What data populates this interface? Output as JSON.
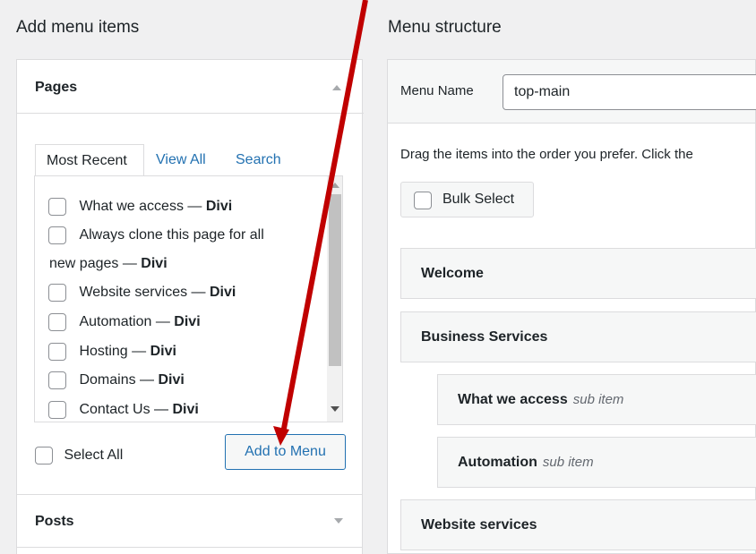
{
  "left": {
    "heading": "Add menu items",
    "pages_title": "Pages",
    "tabs": [
      "Most Recent",
      "View All",
      "Search"
    ],
    "pages": [
      {
        "title": "What we access",
        "suffix": "Divi"
      },
      {
        "title": "Always clone this page for all",
        "title2": "new pages",
        "suffix": "Divi"
      },
      {
        "title": "Website services",
        "suffix": "Divi"
      },
      {
        "title": "Automation",
        "suffix": "Divi"
      },
      {
        "title": "Hosting",
        "suffix": "Divi"
      },
      {
        "title": "Domains",
        "suffix": "Divi"
      },
      {
        "title": "Contact Us",
        "suffix": "Divi"
      }
    ],
    "dash": "—",
    "select_all_label": "Select All",
    "add_button_label": "Add to Menu",
    "posts_title": "Posts"
  },
  "right": {
    "heading": "Menu structure",
    "menu_name_label": "Menu Name",
    "menu_name_value": "top-main",
    "instructions": "Drag the items into the order you prefer. Click the",
    "bulk_select_label": "Bulk Select",
    "items": [
      {
        "label": "Welcome",
        "sub": ""
      },
      {
        "label": "Business Services",
        "sub": ""
      },
      {
        "label": "What we access",
        "sub": "sub item"
      },
      {
        "label": "Automation",
        "sub": "sub item"
      },
      {
        "label": "Website services",
        "sub": ""
      }
    ]
  },
  "colors": {
    "accent": "#2271b1",
    "annotation_arrow": "#c00000"
  }
}
